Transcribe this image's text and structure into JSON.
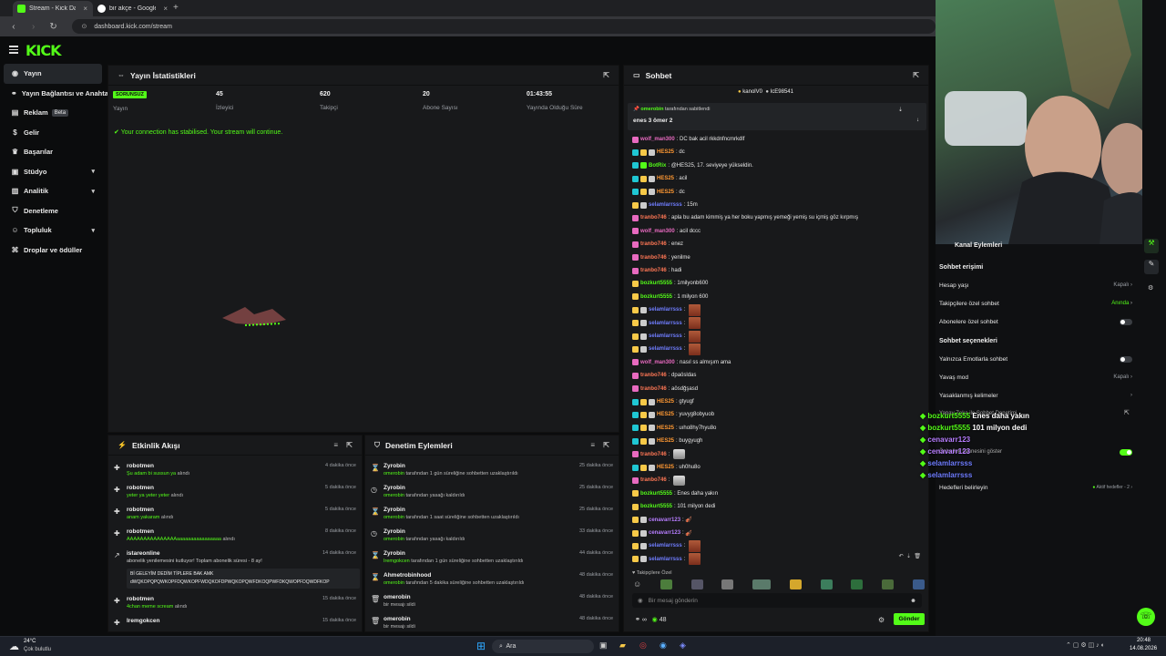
{
  "browser": {
    "tabs": [
      {
        "label": "Stream - Kick Dashboard",
        "active": true
      },
      {
        "label": "bir akçe - Google'da Ara",
        "active": false
      }
    ],
    "url": "dashboard.kick.com/stream"
  },
  "header": {
    "logo": "KICK"
  },
  "sidebar": {
    "items": [
      {
        "label": "Yayın",
        "icon": "broadcast-icon",
        "active": true
      },
      {
        "label": "Yayın Bağlantısı ve Anahtarı",
        "icon": "link-icon"
      },
      {
        "label": "Reklam",
        "icon": "ad-icon",
        "badge": "Beta"
      },
      {
        "label": "Gelir",
        "icon": "money-icon"
      },
      {
        "label": "Başarılar",
        "icon": "trophy-icon"
      },
      {
        "label": "Stüdyo",
        "icon": "studio-icon",
        "chevron": true
      },
      {
        "label": "Analitik",
        "icon": "chart-icon",
        "chevron": true
      },
      {
        "label": "Denetleme",
        "icon": "shield-icon"
      },
      {
        "label": "Topluluk",
        "icon": "community-icon",
        "chevron": true
      },
      {
        "label": "Droplar ve ödüller",
        "icon": "gift-icon"
      }
    ]
  },
  "stats_panel": {
    "title": "Yayın İstatistikleri",
    "stats": [
      {
        "value": "SORUNSUZ",
        "label": "Yayın"
      },
      {
        "value": "45",
        "label": "İzleyici"
      },
      {
        "value": "620",
        "label": "Takipçi"
      },
      {
        "value": "20",
        "label": "Abone Sayısı"
      },
      {
        "value": "01:43:55",
        "label": "Yayında Olduğu Süre"
      }
    ],
    "banner": "Your connection has stabilised. Your stream will continue."
  },
  "activity_panel": {
    "title": "Etkinlik Akışı",
    "items": [
      {
        "name": "robotmen",
        "detail": "Şu adam bi sussun ya",
        "suffix": "alındı",
        "time": "4 dakika önce"
      },
      {
        "name": "robotmen",
        "detail": "yeter ya yeter yeter",
        "suffix": "alındı",
        "time": "5 dakika önce"
      },
      {
        "name": "robotmen",
        "detail": "anam yakaram",
        "suffix": "alındı",
        "time": "5 dakika önce"
      },
      {
        "name": "robotmen",
        "detail": "AAAAAAAAAAAAAAAaaaaaaaaaaaaaaaa",
        "suffix": "alındı",
        "time": "8 dakika önce"
      },
      {
        "name": "istareonline",
        "detail": "abonelik yenilemesini kutluyor! Toplam abonelik süresi - 8 ay!",
        "suffix": "",
        "time": "14 dakika önce"
      },
      {
        "name": "robotmen",
        "detail": "4chan meme scream",
        "suffix": "alındı",
        "time": "15 dakika önce"
      },
      {
        "name": "Iremgokcen",
        "detail": "",
        "suffix": "",
        "time": "15 dakika önce"
      }
    ],
    "quote_1": "Bİ GELEYİM DEDİM TİPLERE BAK AMK",
    "quote_2": "dWQKOPQPQWKOPFDQWKOPFWDQKOFDPWQKOPQWFDKOQPWFDKQWOPFDQWDFKOP"
  },
  "mod_panel": {
    "title": "Denetim Eylemleri",
    "items": [
      {
        "name": "Zyrobin",
        "detail": "omerobin",
        "suffix": "tarafından 1 gün süreliğine sohbetten uzaklaştırıldı",
        "time": "25 dakika önce",
        "icon": "timeout-icon"
      },
      {
        "name": "Zyrobin",
        "detail": "omerobin",
        "suffix": "tarafından yasağı kaldırıldı",
        "time": "25 dakika önce",
        "icon": "unban-icon"
      },
      {
        "name": "Zyrobin",
        "detail": "omerobin",
        "suffix": "tarafından 1 saat süreliğine sohbetten uzaklaştırıldı",
        "time": "25 dakika önce",
        "icon": "timeout-icon"
      },
      {
        "name": "Zyrobin",
        "detail": "omerobin",
        "suffix": "tarafından yasağı kaldırıldı",
        "time": "33 dakika önce",
        "icon": "unban-icon"
      },
      {
        "name": "Zyrobin",
        "detail": "Iremgokcen",
        "suffix": "tarafından 1 gün süreliğine sohbetten uzaklaştırıldı",
        "time": "44 dakika önce",
        "icon": "timeout-icon"
      },
      {
        "name": "Ahmetrobinhood",
        "detail": "omerobin",
        "suffix": "tarafından 5 dakika süreliğine sohbetten uzaklaştırıldı",
        "time": "48 dakika önce",
        "icon": "timeout-icon"
      },
      {
        "name": "omerobin",
        "detail": "bir mesajı sildi",
        "suffix": "",
        "time": "48 dakika önce",
        "icon": "trash-icon"
      },
      {
        "name": "omerobin",
        "detail": "bir mesajı sildi",
        "suffix": "",
        "time": "48 dakika önce",
        "icon": "trash-icon"
      }
    ]
  },
  "chat": {
    "title": "Sohbet",
    "top_users": [
      "kanolV0",
      "IcE98541"
    ],
    "pinned_by": "omerobin",
    "pinned_label": "tarafından sabitlendi",
    "pinned_msg": "enes 3 ömer 2",
    "messages": [
      {
        "u": "wolf_man300",
        "m": "DC bak acil rkkdnfncmrkdlf",
        "c": "#e86ac0",
        "b": [
          "#e86ac0"
        ]
      },
      {
        "u": "HES25",
        "m": "dc",
        "c": "#ff9933",
        "b": [
          "#1fc7d4",
          "#f7c948",
          "#ccc"
        ]
      },
      {
        "u": "BotRix",
        "m": "@HES25, 17. seviyeye yükseldin.",
        "c": "#53fc18",
        "b": [
          "#1fc7d4",
          "#53fc18"
        ]
      },
      {
        "u": "HES25",
        "m": "acil",
        "c": "#ff9933",
        "b": [
          "#1fc7d4",
          "#f7c948",
          "#ccc"
        ]
      },
      {
        "u": "HES25",
        "m": "dc",
        "c": "#ff9933",
        "b": [
          "#1fc7d4",
          "#f7c948",
          "#ccc"
        ]
      },
      {
        "u": "selamlarrsss",
        "m": "15m",
        "c": "#6f7dff",
        "b": [
          "#f7c948",
          "#ccc"
        ]
      },
      {
        "u": "tranbo746",
        "m": "apla bu adam kimmiş ya her boku yapmış yemeği yemiş su içmiş göz kırpmış",
        "c": "#ff7755",
        "b": [
          "#e86ac0"
        ]
      },
      {
        "u": "wolf_man300",
        "m": "acil dccc",
        "c": "#e86ac0",
        "b": [
          "#e86ac0"
        ]
      },
      {
        "u": "tranbo746",
        "m": "enez",
        "c": "#ff7755",
        "b": [
          "#e86ac0"
        ]
      },
      {
        "u": "tranbo746",
        "m": "yenilme",
        "c": "#ff7755",
        "b": [
          "#e86ac0"
        ]
      },
      {
        "u": "tranbo746",
        "m": "hadi",
        "c": "#ff7755",
        "b": [
          "#e86ac0"
        ]
      },
      {
        "u": "bozkurt5555",
        "m": "1milyonb600",
        "c": "#53fc18",
        "b": [
          "#f7c948"
        ]
      },
      {
        "u": "bozkurt5555",
        "m": "1 milyon 600",
        "c": "#53fc18",
        "b": [
          "#f7c948"
        ]
      },
      {
        "u": "selamlarrsss",
        "m": "",
        "c": "#6f7dff",
        "b": [
          "#f7c948",
          "#ccc"
        ],
        "emote": true
      },
      {
        "u": "selamlarrsss",
        "m": "",
        "c": "#6f7dff",
        "b": [
          "#f7c948",
          "#ccc"
        ],
        "emote": true
      },
      {
        "u": "selamlarrsss",
        "m": "",
        "c": "#6f7dff",
        "b": [
          "#f7c948",
          "#ccc"
        ],
        "emote": true
      },
      {
        "u": "selamlarrsss",
        "m": "",
        "c": "#6f7dff",
        "b": [
          "#f7c948",
          "#ccc"
        ],
        "emote": true
      },
      {
        "u": "wolf_man300",
        "m": "nasıl ss almışım ama",
        "c": "#e86ac0",
        "b": [
          "#e86ac0"
        ]
      },
      {
        "u": "tranbo746",
        "m": "dpaösldas",
        "c": "#ff7755",
        "b": [
          "#e86ac0"
        ]
      },
      {
        "u": "tranbo746",
        "m": "aösdğşasd",
        "c": "#ff7755",
        "b": [
          "#e86ac0"
        ]
      },
      {
        "u": "HES25",
        "m": "gtyugf",
        "c": "#ff9933",
        "b": [
          "#1fc7d4",
          "#f7c948",
          "#ccc"
        ]
      },
      {
        "u": "HES25",
        "m": "yuvyg8obyuob",
        "c": "#ff9933",
        "b": [
          "#1fc7d4",
          "#f7c948",
          "#ccc"
        ]
      },
      {
        "u": "HES25",
        "m": "uıho8hy7hyu8o",
        "c": "#ff9933",
        "b": [
          "#1fc7d4",
          "#f7c948",
          "#ccc"
        ]
      },
      {
        "u": "HES25",
        "m": "buygyugh",
        "c": "#ff9933",
        "b": [
          "#1fc7d4",
          "#f7c948",
          "#ccc"
        ]
      },
      {
        "u": "tranbo746",
        "m": "",
        "c": "#ff7755",
        "b": [
          "#e86ac0"
        ],
        "emote2": true
      },
      {
        "u": "HES25",
        "m": "uh0hu8o",
        "c": "#ff9933",
        "b": [
          "#1fc7d4",
          "#f7c948",
          "#ccc"
        ]
      },
      {
        "u": "tranbo746",
        "m": "",
        "c": "#ff7755",
        "b": [
          "#e86ac0"
        ],
        "emote2": true
      },
      {
        "u": "bozkurt5555",
        "m": "Enes daha yakın",
        "c": "#53fc18",
        "b": [
          "#f7c948"
        ]
      },
      {
        "u": "bozkurt5555",
        "m": "101 milyon dedi",
        "c": "#53fc18",
        "b": [
          "#f7c948"
        ]
      },
      {
        "u": "cenavarr123",
        "m": "🎻",
        "c": "#b77dff",
        "b": [
          "#f7c948",
          "#ccc"
        ]
      },
      {
        "u": "cenavarr123",
        "m": "🎻",
        "c": "#b77dff",
        "b": [
          "#f7c948",
          "#ccc"
        ]
      },
      {
        "u": "selamlarrsss",
        "m": "",
        "c": "#6f7dff",
        "b": [
          "#f7c948",
          "#ccc"
        ],
        "emote": true
      },
      {
        "u": "selamlarrsss",
        "m": "",
        "c": "#6f7dff",
        "b": [
          "#f7c948",
          "#ccc"
        ],
        "emote": true
      }
    ],
    "followers_only": "Takipçilere Özel",
    "input_placeholder": "Bir mesaj gönderin",
    "viewer_count": "48",
    "send_label": "Gönder"
  },
  "channel_settings": {
    "title": "Kanal Eylemleri",
    "chat_access": "Sohbet erişimi",
    "rows_access": [
      {
        "label": "Hesap yaşı",
        "value": "Kapalı"
      },
      {
        "label": "Takipçilere özel sohbet",
        "value": "Anında"
      },
      {
        "label": "Abonelere özel sohbet",
        "value": ""
      }
    ],
    "chat_options": "Sohbet seçenekleri",
    "rows_options": [
      {
        "label": "Yalnızca Emotlarla sohbet",
        "value": ""
      },
      {
        "label": "Yavaş mod",
        "value": "Kapalı"
      },
      {
        "label": "Yasaklanmış kelimeler",
        "value": ""
      }
    ],
    "ai_label": "Yapay Zeka ile Sohbet Denetimi",
    "show_label": "Önbellek sahnesini göster",
    "goals_label": "Hedefleri belirleyin",
    "goals_value": "Aktif hedefler - 2",
    "overlay": [
      {
        "u": "bozkurt5555",
        "m": "Enes daha yakın"
      },
      {
        "u": "bozkurt5555",
        "m": "101 milyon dedi"
      },
      {
        "u": "cenavarr123",
        "m": ""
      },
      {
        "u": "cenavarr123",
        "m": ""
      },
      {
        "u": "selamlarrsss",
        "m": ""
      },
      {
        "u": "selamlarrsss",
        "m": ""
      }
    ]
  },
  "taskbar": {
    "weather_temp": "24°C",
    "weather_desc": "Çok bulutlu",
    "search": "Ara",
    "time": "20:48",
    "date": "14.08.2026"
  }
}
